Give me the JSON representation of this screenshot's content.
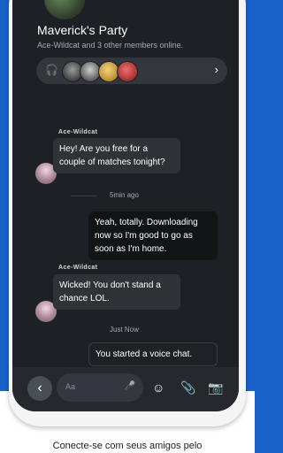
{
  "party": {
    "title": "Maverick's Party",
    "subtitle": "Ace-Wildcat and 3 other members online."
  },
  "icons": {
    "headset": "headset-icon",
    "chevron": "chevron-right-icon",
    "back": "chevron-left-icon",
    "mic": "microphone-icon",
    "emoji": "emoji-icon",
    "attach": "paperclip-icon",
    "camera": "camera-icon"
  },
  "messages": [
    {
      "sender": "Ace-Wildcat",
      "text": "Hey! Are you free for a couple of matches tonight?"
    },
    {
      "time": "5min ago"
    },
    {
      "text": "Yeah, totally. Downloading now so I'm good to go as soon as I'm home."
    },
    {
      "sender": "Ace-Wildcat",
      "text": "Wicked! You don't stand a chance LOL."
    },
    {
      "time": "Just Now"
    },
    {
      "text": "You started a voice chat."
    }
  ],
  "composer": {
    "placeholder": "Aa"
  },
  "caption": "Conecte-se com seus amigos pelo"
}
